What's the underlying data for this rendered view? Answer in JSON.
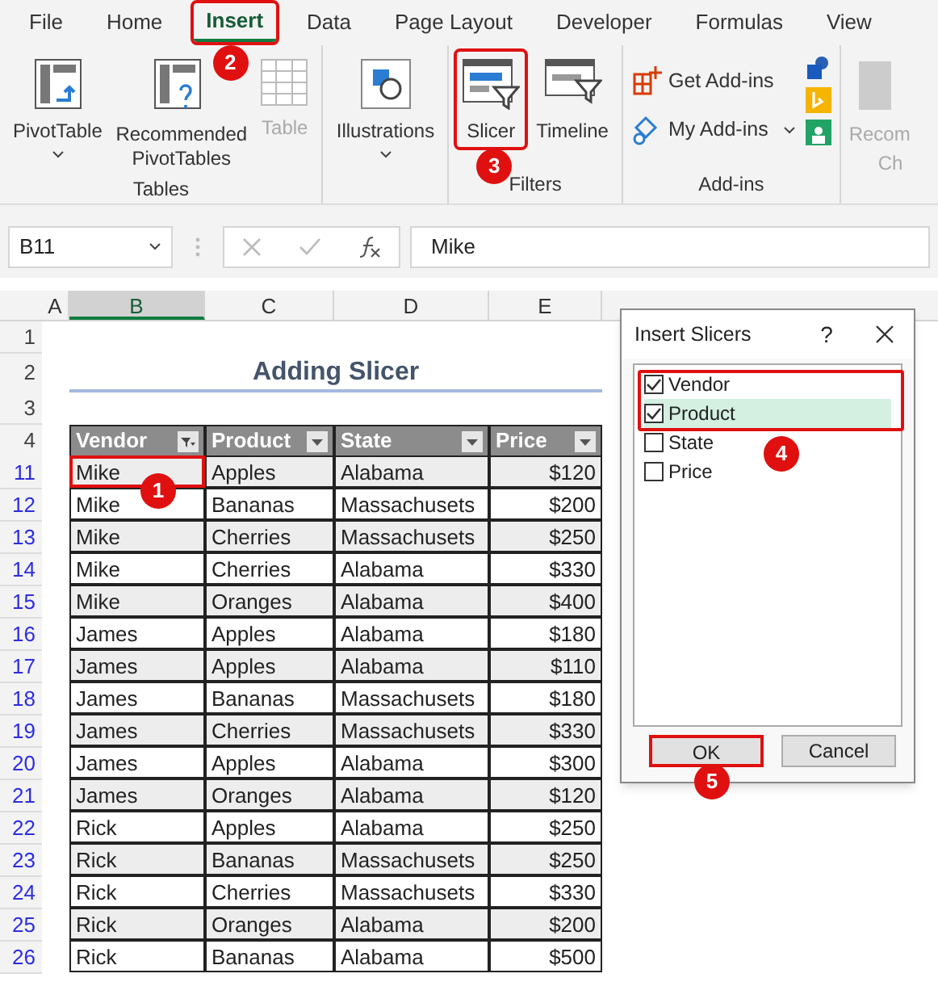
{
  "tabs": [
    {
      "label": "File",
      "selected": false,
      "highlighted": false
    },
    {
      "label": "Home",
      "selected": false,
      "highlighted": false
    },
    {
      "label": "Insert",
      "selected": true,
      "highlighted": true,
      "step": "2"
    },
    {
      "label": "Data",
      "selected": false,
      "highlighted": false
    },
    {
      "label": "Page Layout",
      "selected": false,
      "highlighted": false
    },
    {
      "label": "Developer",
      "selected": false,
      "highlighted": false
    },
    {
      "label": "Formulas",
      "selected": false,
      "highlighted": false
    },
    {
      "label": "View",
      "selected": false,
      "highlighted": false
    }
  ],
  "ribbon": [
    {
      "label": "Tables",
      "items": [
        {
          "kind": "pivot",
          "label": "PivotTable",
          "caret": true,
          "disabled": false
        },
        {
          "kind": "recommended",
          "label": "Recommended PivotTables",
          "disabled": false
        },
        {
          "kind": "table",
          "label": "Table",
          "disabled": true
        }
      ]
    },
    {
      "items": [
        {
          "kind": "illustrations",
          "label": "Illustrations",
          "caret": true,
          "disabled": false
        }
      ]
    },
    {
      "label": "Filters",
      "items": [
        {
          "kind": "slicer",
          "label": "Slicer",
          "disabled": false,
          "highlighted": true,
          "step": "3"
        },
        {
          "kind": "timeline",
          "label": "Timeline",
          "disabled": false,
          "highlighted": false
        }
      ]
    },
    {
      "label": "Add-ins",
      "items": [
        {
          "kind": "addins",
          "label": "Get Add-ins",
          "disabled": false
        },
        {
          "kind": "myaddins",
          "label": "My Add-ins",
          "disabled": false
        }
      ]
    },
    {
      "items": [
        {
          "kind": "cut",
          "label": "Recom",
          "label2": "Ch",
          "disabled": true
        }
      ]
    }
  ],
  "name_box": "B11",
  "formula": "Mike",
  "columns": [
    {
      "label": "A",
      "selected": false
    },
    {
      "label": "B",
      "selected": true
    },
    {
      "label": "C",
      "selected": false
    },
    {
      "label": "D",
      "selected": false
    },
    {
      "label": "E",
      "selected": false
    }
  ],
  "title": {
    "row": "2",
    "text": "Adding Slicer"
  },
  "blank_rows": [
    "1",
    "3"
  ],
  "header": {
    "row": "4",
    "cells": [
      "Vendor",
      "Product",
      "State",
      "Price"
    ],
    "filtered": [
      true,
      false,
      false,
      false
    ]
  },
  "rows": [
    {
      "number": "11",
      "cells": [
        "Mike",
        "Apples",
        "Alabama",
        "$120"
      ],
      "active": true,
      "step": "1"
    },
    {
      "number": "12",
      "cells": [
        "Mike",
        "Bananas",
        "Massachusets",
        "$200"
      ]
    },
    {
      "number": "13",
      "cells": [
        "Mike",
        "Cherries",
        "Massachusets",
        "$250"
      ]
    },
    {
      "number": "14",
      "cells": [
        "Mike",
        "Cherries",
        "Alabama",
        "$330"
      ]
    },
    {
      "number": "15",
      "cells": [
        "Mike",
        "Oranges",
        "Alabama",
        "$400"
      ]
    },
    {
      "number": "16",
      "cells": [
        "James",
        "Apples",
        "Alabama",
        "$180"
      ]
    },
    {
      "number": "17",
      "cells": [
        "James",
        "Apples",
        "Alabama",
        "$110"
      ]
    },
    {
      "number": "18",
      "cells": [
        "James",
        "Bananas",
        "Massachusets",
        "$180"
      ]
    },
    {
      "number": "19",
      "cells": [
        "James",
        "Cherries",
        "Massachusets",
        "$330"
      ]
    },
    {
      "number": "20",
      "cells": [
        "James",
        "Apples",
        "Alabama",
        "$300"
      ]
    },
    {
      "number": "21",
      "cells": [
        "James",
        "Oranges",
        "Alabama",
        "$120"
      ]
    },
    {
      "number": "22",
      "cells": [
        "Rick",
        "Apples",
        "Alabama",
        "$250"
      ]
    },
    {
      "number": "23",
      "cells": [
        "Rick",
        "Bananas",
        "Massachusets",
        "$250"
      ]
    },
    {
      "number": "24",
      "cells": [
        "Rick",
        "Cherries",
        "Massachusets",
        "$330"
      ]
    },
    {
      "number": "25",
      "cells": [
        "Rick",
        "Oranges",
        "Alabama",
        "$200"
      ]
    },
    {
      "number": "26",
      "cells": [
        "Rick",
        "Bananas",
        "Alabama",
        "$500"
      ]
    }
  ],
  "dialog": {
    "title": "Insert Slicers",
    "help": "?",
    "fields": [
      {
        "label": "Vendor",
        "checked": true,
        "selected": false
      },
      {
        "label": "Product",
        "checked": true,
        "selected": true
      },
      {
        "label": "State",
        "checked": false,
        "selected": false
      },
      {
        "label": "Price",
        "checked": false,
        "selected": false
      }
    ],
    "highlight_step": "4",
    "buttons": [
      {
        "label": "OK",
        "highlighted": true,
        "step": "5"
      },
      {
        "label": "Cancel",
        "highlighted": false
      }
    ]
  }
}
